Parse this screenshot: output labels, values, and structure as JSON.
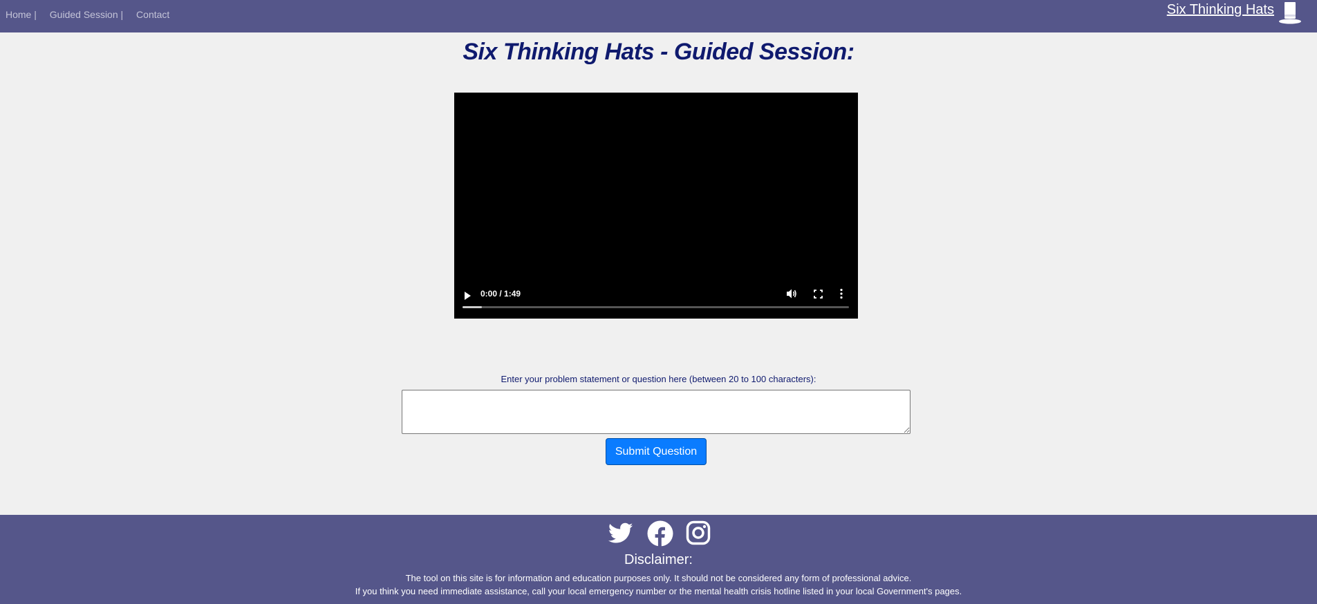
{
  "nav": {
    "items": [
      {
        "label": "Home",
        "sep": "|"
      },
      {
        "label": "Guided Session",
        "sep": "|"
      },
      {
        "label": "Contact",
        "sep": ""
      }
    ],
    "brand": "Six Thinking Hats",
    "brand_icon": "top-hat-icon"
  },
  "main": {
    "title": "Six Thinking Hats - Guided Session:",
    "video": {
      "time": "0:00 / 1:49",
      "progress": 0.05
    },
    "form": {
      "label": "Enter your problem statement or question here (between 20 to 100 characters):",
      "value": "",
      "placeholder": "",
      "submit_label": "Submit Question"
    }
  },
  "footer": {
    "social_icons": [
      "twitter-icon",
      "facebook-icon",
      "instagram-icon"
    ],
    "disclaimer_title": "Disclaimer:",
    "disclaimer_lines": [
      "The tool on this site is for information and education purposes only. It should not be considered any form of professional advice.",
      "If you think you need immediate assistance, call your local emergency number or the mental health crisis hotline listed in your local Government's pages."
    ]
  },
  "colors": {
    "navbar": "#55568a",
    "title": "#0f1a6e",
    "button": "#0a7cff",
    "background": "#f0f0f0"
  }
}
